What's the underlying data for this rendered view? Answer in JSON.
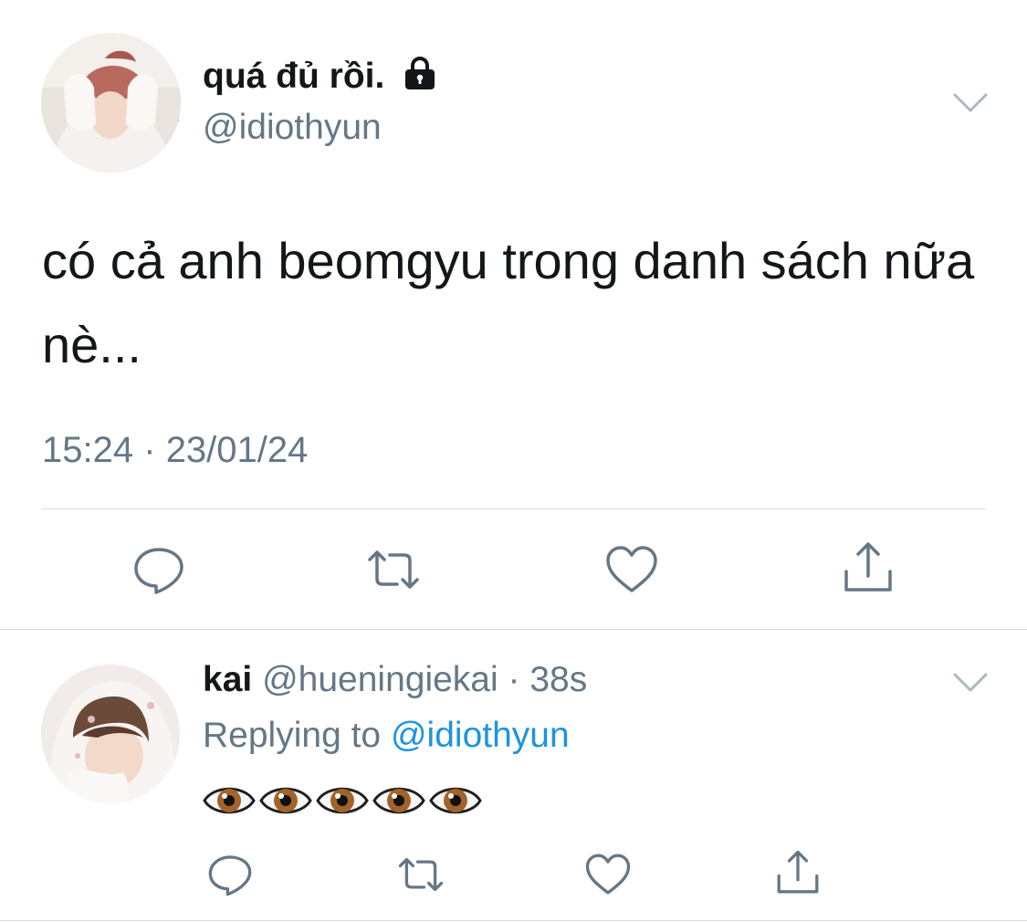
{
  "main_tweet": {
    "display_name": "quá đủ rồi.",
    "handle": "@idiothyun",
    "text": "có cả anh beomgyu trong danh sách nữa nè...",
    "time": "15:24",
    "separator": "·",
    "date": "23/01/24",
    "protected_icon": "lock-icon",
    "actions": [
      "reply-icon",
      "retweet-icon",
      "like-icon",
      "share-icon"
    ]
  },
  "reply_tweet": {
    "display_name": "kai",
    "handle": "@hueningiekai",
    "separator": "·",
    "time_ago": "38s",
    "replying_to_label": "Replying to",
    "replying_to_handle": "@idiothyun",
    "emoji_text": "👁👁👁👁👁",
    "actions": [
      "reply-icon",
      "retweet-icon",
      "like-icon",
      "share-icon"
    ]
  },
  "colors": {
    "text": "#14171a",
    "secondary": "#657786",
    "link": "#1b95e0",
    "divider": "#d8dde1"
  }
}
